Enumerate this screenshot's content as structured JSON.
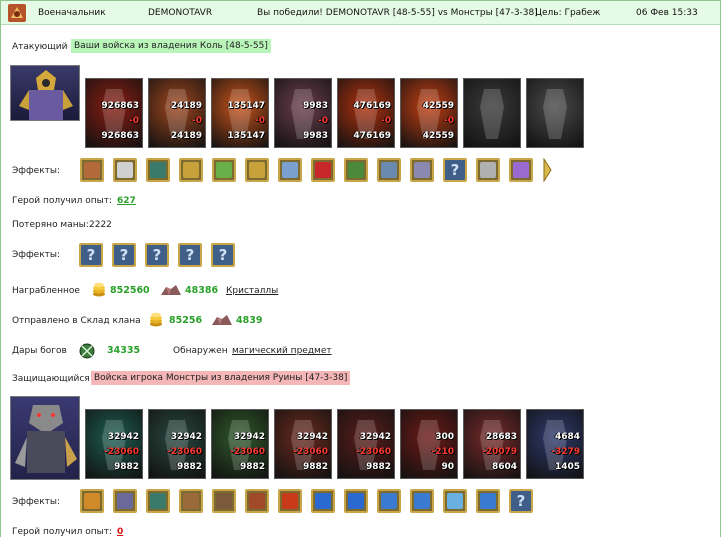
{
  "header": {
    "title": "Военачальник",
    "player": "DEMONOTAVR",
    "result": "Вы победили! DEMONOTAVR [48-5-55] vs Монстры [47-3-38].",
    "goal": "Цель: Грабеж",
    "datetime": "06 Фев 15:33"
  },
  "attacker": {
    "label": "Атакующий",
    "troops_label": "Ваши войска из владения Коль [48-5-55]",
    "units": [
      {
        "top": "926863",
        "loss": "-0",
        "bottom": "926863",
        "color": "#8b1d12"
      },
      {
        "top": "24189",
        "loss": "-0",
        "bottom": "24189",
        "color": "#a0461e"
      },
      {
        "top": "135147",
        "loss": "-0",
        "bottom": "135147",
        "color": "#c9541a"
      },
      {
        "top": "9983",
        "loss": "-0",
        "bottom": "9983",
        "color": "#6b3d4d"
      },
      {
        "top": "476169",
        "loss": "-0",
        "bottom": "476169",
        "color": "#b1320f"
      },
      {
        "top": "42559",
        "loss": "-0",
        "bottom": "42559",
        "color": "#c43f12"
      },
      {
        "top": "",
        "loss": "",
        "bottom": "",
        "color": "#3a3a3a"
      },
      {
        "top": "",
        "loss": "",
        "bottom": "",
        "color": "#4a4a4a"
      }
    ],
    "effects_label": "Эффекты:",
    "effects": [
      "chest-icon",
      "dice-icon",
      "shield-icon",
      "handshake-icon",
      "sword-icon",
      "handshake-icon",
      "potion-icon",
      "xp-icon",
      "creature-icon",
      "claw-icon",
      "scorpion-icon",
      "question-icon",
      "scroll-icon",
      "bow-icon"
    ],
    "xp_label": "Герой получил опыт:",
    "xp_value": "627",
    "mana_label": "Потеряно маны:",
    "mana_value": "2222",
    "effects2_label": "Эффекты:",
    "effects2": [
      "question-icon",
      "question-icon",
      "question-icon",
      "question-icon",
      "question-icon"
    ],
    "loot_label": "Награбленное",
    "loot_gold": "852560",
    "loot_ore": "48386",
    "loot_link": "Кристаллы",
    "clan_label": "Отправлено в Склад клана",
    "clan_gold": "85256",
    "clan_ore": "4839",
    "gifts_label": "Дары богов",
    "gifts_value": "34335",
    "found_label": "Обнаружен",
    "found_link": "магический предмет"
  },
  "defender": {
    "label": "Защищающийся",
    "troops_label": "Войска игрока Монстры из владения Руины [47-3-38]",
    "units": [
      {
        "top": "32942",
        "loss": "-23060",
        "bottom": "9882",
        "color": "#1d5e52"
      },
      {
        "top": "32942",
        "loss": "-23060",
        "bottom": "9882",
        "color": "#28483f"
      },
      {
        "top": "32942",
        "loss": "-23060",
        "bottom": "9882",
        "color": "#2f5a2a"
      },
      {
        "top": "32942",
        "loss": "-23060",
        "bottom": "9882",
        "color": "#6a2a1e"
      },
      {
        "top": "32942",
        "loss": "-23060",
        "bottom": "9882",
        "color": "#5a1d1a"
      },
      {
        "top": "300",
        "loss": "-210",
        "bottom": "90",
        "color": "#6d1a16"
      },
      {
        "top": "28683",
        "loss": "-20079",
        "bottom": "8604",
        "color": "#7a2a2a"
      },
      {
        "top": "4684",
        "loss": "-3279",
        "bottom": "1405",
        "color": "#2e3a6e"
      }
    ],
    "effects_label": "Эффекты:",
    "effects": [
      "lantern-icon",
      "crossbow-icon",
      "shield-icon",
      "book-icon",
      "tome-icon",
      "hammers-icon",
      "helmet-icon",
      "dragon-icon",
      "dragon-icon",
      "rune-icon",
      "rune-icon",
      "staff-icon",
      "rune-icon",
      "question-icon"
    ],
    "xp_label": "Герой получил опыт:",
    "xp_value": "0"
  },
  "colors": {
    "header_bg": "#e5fbe5",
    "green_tag": "#b9f5b9",
    "red_tag": "#f4b6b6",
    "gain_green": "#2aa12a",
    "loss_red": "#d11"
  }
}
